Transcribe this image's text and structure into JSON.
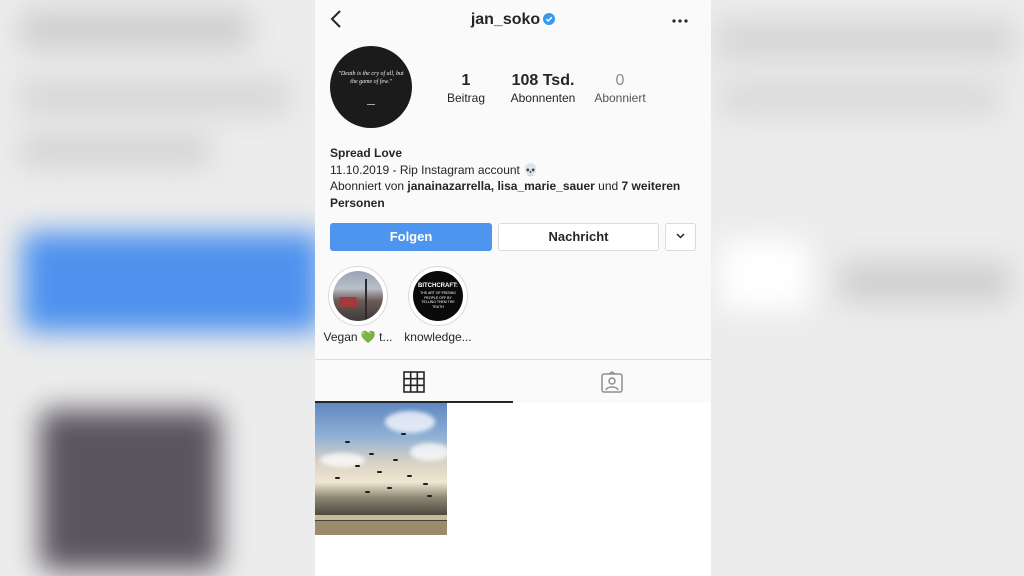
{
  "profile": {
    "username": "jan_soko",
    "avatar_quote": "\"Death is the cry of all, but the game of few.\"",
    "stats": [
      {
        "value": "1",
        "label": "Beitrag"
      },
      {
        "value": "108 Tsd.",
        "label": "Abonnenten"
      },
      {
        "value": "0",
        "label": "Abonniert"
      }
    ],
    "bio": {
      "name": "Spread Love",
      "line1": "11.10.2019 - Rip Instagram account 💀",
      "followed_prefix": "Abonniert von ",
      "followed_users": "janainazarrella, lisa_marie_sauer",
      "followed_mid": " und ",
      "followed_more": "7 weiteren Personen"
    }
  },
  "buttons": {
    "follow": "Folgen",
    "message": "Nachricht"
  },
  "highlights": [
    {
      "caption": "Vegan 💚 t..."
    },
    {
      "caption": "knowledge...",
      "cover_title": "BITCHCRAFT:",
      "cover_sub": "THE ART OF PISSING PEOPLE OFF BY TELLING THEM THE TRUTH"
    }
  ],
  "icons": {
    "back": "chevron-left-icon",
    "verified": "verified-badge-icon",
    "more": "more-horizontal-icon",
    "dropdown": "chevron-down-icon",
    "grid": "grid-icon",
    "tagged": "tagged-person-icon"
  },
  "colors": {
    "follow_button": "#4d95ee",
    "verified": "#3897f0",
    "text": "#262626"
  }
}
